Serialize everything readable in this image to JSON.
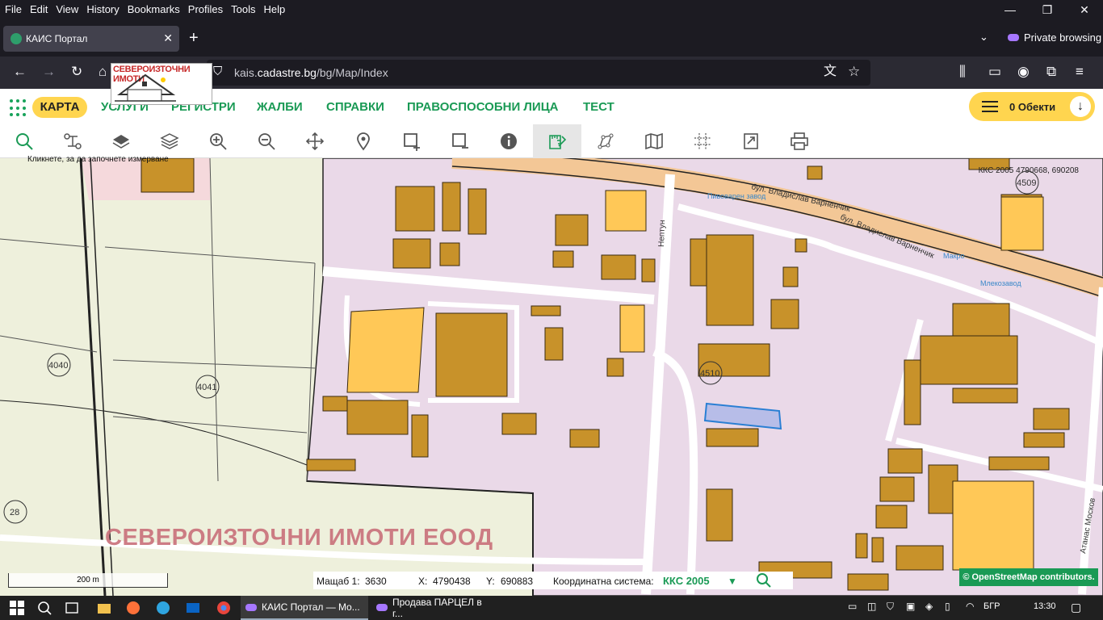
{
  "menubar": {
    "items": [
      "File",
      "Edit",
      "View",
      "History",
      "Bookmarks",
      "Profiles",
      "Tools",
      "Help"
    ]
  },
  "window_controls": {
    "minimize": "—",
    "restore": "❐",
    "close": "✕"
  },
  "tab": {
    "title": "КАИС Портал",
    "close": "✕"
  },
  "newtab": "+",
  "private_label": "Private browsing",
  "url": {
    "domain_prefix": "kais.",
    "domain": "cadastre.bg",
    "path": "/bg/Map/Index"
  },
  "logo_text": "СЕВЕРОИЗТОЧНИ ИМОТИ",
  "appnav": {
    "karta": "КАРТА",
    "items": [
      "УСЛУГИ",
      "РЕГИСТРИ",
      "ЖАЛБИ",
      "СПРАВКИ",
      "ПРАВОСПОСОБНИ ЛИЦА",
      "ТЕСТ"
    ],
    "objects_label": "0 Обекти"
  },
  "toolbar": {
    "tools": [
      "search-icon",
      "route-icon",
      "layers-icon",
      "layers-stack-icon",
      "zoom-in-icon",
      "zoom-out-icon",
      "pan-icon",
      "pin-icon",
      "select-add-icon",
      "select-remove-icon",
      "info-icon",
      "measure-icon",
      "vertex-icon",
      "map-icon",
      "grid-icon",
      "export-icon",
      "print-icon"
    ],
    "active_index": 11
  },
  "hint": "Кликнете, за да започнете измерване",
  "map": {
    "coords_top": "ККС 2005 4790668, 690208",
    "labels": [
      "4040",
      "4041",
      "4509",
      "4510",
      "28"
    ],
    "streets": [
      "бул. Владислав Варненчик",
      "бул. Владислав Варненчик",
      "Нептун",
      "Атанас Москов"
    ],
    "pois": [
      "Пивоварен завод",
      "Макро",
      "Млекозавод"
    ],
    "watermark": "СЕВЕРОИЗТОЧНИ ИМОТИ ЕООД",
    "scale_label": "200 m",
    "osm": "© OpenStreetMap contributors."
  },
  "status": {
    "scale_label": "Мащаб 1:",
    "scale": "3630",
    "x_label": "X:",
    "x": "4790438",
    "y_label": "Y:",
    "y": "690883",
    "cs_label": "Координатна система:",
    "cs": "ККС 2005"
  },
  "taskbar": {
    "tasks": [
      "КАИС Портал — Mo...",
      "Продава ПАРЦЕЛ в г..."
    ],
    "lang": "БГР",
    "time": "13:30"
  }
}
